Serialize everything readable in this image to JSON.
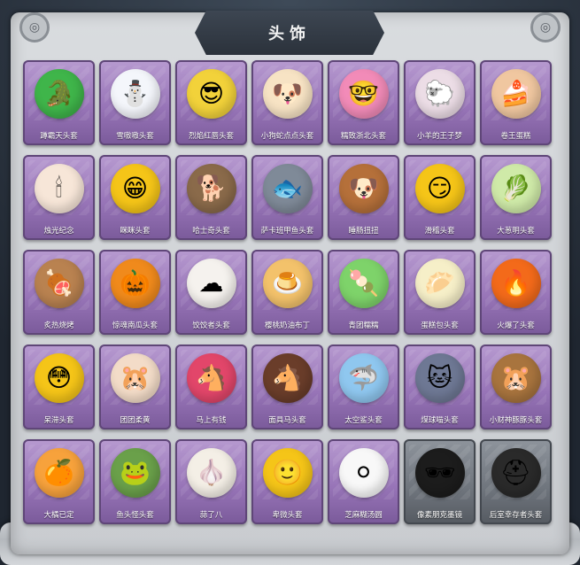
{
  "title": "头饰",
  "items": [
    {
      "name": "蹲霸天头套",
      "icon": "crocodile-head",
      "color": "#3fb54a",
      "glyph": "🐊"
    },
    {
      "name": "雪嗷嗷头套",
      "icon": "snowman-head",
      "color": "#f4f6fb",
      "glyph": "⛄"
    },
    {
      "name": "烈焰红唇头套",
      "icon": "pikachu-sunglasses-head",
      "color": "#f2d23a",
      "glyph": "😎"
    },
    {
      "name": "小狗蛇点点头套",
      "icon": "spotted-dog-head",
      "color": "#f7e3c4",
      "glyph": "🐶"
    },
    {
      "name": "糯致浙北头套",
      "icon": "pink-glasses-head",
      "color": "#f28bb8",
      "glyph": "🤓"
    },
    {
      "name": "小羊的王子梦",
      "icon": "sheep-crown-head",
      "color": "#ecdde6",
      "glyph": "🐑"
    },
    {
      "name": "卷王蛋糕",
      "icon": "roll-cake-head",
      "color": "#f0c7a0",
      "glyph": "🍰"
    },
    {
      "name": "烛光纪念",
      "icon": "candle-head",
      "color": "#f7e6d8",
      "glyph": "🕯"
    },
    {
      "name": "眯眯头套",
      "icon": "grin-emoji-head",
      "color": "#f5c518",
      "glyph": "😁"
    },
    {
      "name": "哈士奇头套",
      "icon": "husky-sunglasses-head",
      "color": "#8a6a4a",
      "glyph": "🐕"
    },
    {
      "name": "萨卡班甲鱼头套",
      "icon": "fish-head",
      "color": "#7f8a98",
      "glyph": "🐟"
    },
    {
      "name": "睡肠扭扭",
      "icon": "sausage-dog-head",
      "color": "#b5703a",
      "glyph": "🐶"
    },
    {
      "name": "滑稽头套",
      "icon": "smirk-emoji-head",
      "color": "#f5c518",
      "glyph": "😏"
    },
    {
      "name": "大葱明头套",
      "icon": "green-onion-head",
      "color": "#cfeaa8",
      "glyph": "🥬"
    },
    {
      "name": "炙热烧烤",
      "icon": "bbq-meat-head",
      "color": "#b98250",
      "glyph": "🍖"
    },
    {
      "name": "惊魂南瓜头套",
      "icon": "pumpkin-head",
      "color": "#f08a1c",
      "glyph": "🎃"
    },
    {
      "name": "饺饺者头套",
      "icon": "dumpling-cloud-head",
      "color": "#f5f2ee",
      "glyph": "☁"
    },
    {
      "name": "樱桃奶油布丁",
      "icon": "pudding-head",
      "color": "#f3c26b",
      "glyph": "🍮"
    },
    {
      "name": "青团糯糯",
      "icon": "green-rice-ball-head",
      "color": "#7ed36a",
      "glyph": "🍡"
    },
    {
      "name": "蛋糕包头套",
      "icon": "bun-king-head",
      "color": "#f6efc8",
      "glyph": "🥟"
    },
    {
      "name": "火爆了头套",
      "icon": "fire-head",
      "color": "#f36a1a",
      "glyph": "🔥"
    },
    {
      "name": "呆滞头套",
      "icon": "flushed-emoji-head",
      "color": "#f5c518",
      "glyph": "😳"
    },
    {
      "name": "团团柔黄",
      "icon": "hamster-head",
      "color": "#f3dcc8",
      "glyph": "🐹"
    },
    {
      "name": "马上有钱",
      "icon": "red-horse-head",
      "color": "#e2466a",
      "glyph": "🐴"
    },
    {
      "name": "面具马头套",
      "icon": "horse-mask-head",
      "color": "#6a3d2a",
      "glyph": "🐴"
    },
    {
      "name": "太空鲨头套",
      "icon": "shark-head",
      "color": "#8fc7ef",
      "glyph": "🦈"
    },
    {
      "name": "煤球喵头套",
      "icon": "grey-cat-head",
      "color": "#6e7894",
      "glyph": "🐱"
    },
    {
      "name": "小财神豚豚头套",
      "icon": "capybara-head",
      "color": "#a8743e",
      "glyph": "🐹"
    },
    {
      "name": "大橘已定",
      "icon": "orange-slice-head",
      "color": "#f7a23c",
      "glyph": "🍊"
    },
    {
      "name": "鱼头怪头套",
      "icon": "fish-monster-head",
      "color": "#6aa04a",
      "glyph": "🐸"
    },
    {
      "name": "蒜了八",
      "icon": "garlic-head",
      "color": "#f4efe6",
      "glyph": "🧄"
    },
    {
      "name": "卑微头套",
      "icon": "meek-emoji-head",
      "color": "#f5c518",
      "glyph": "🙂"
    },
    {
      "name": "芝麻糊汤圆",
      "icon": "tangyuan-head",
      "color": "#f8f8f8",
      "glyph": "⚪"
    },
    {
      "name": "像素朋克墨镜",
      "icon": "pixel-sunglasses",
      "color": "#1c1c1c",
      "glyph": "🕶",
      "dark": true
    },
    {
      "name": "后室幸存者头套",
      "icon": "gas-mask-helmet",
      "color": "#2a2a2a",
      "glyph": "⛑",
      "dark": true
    }
  ]
}
